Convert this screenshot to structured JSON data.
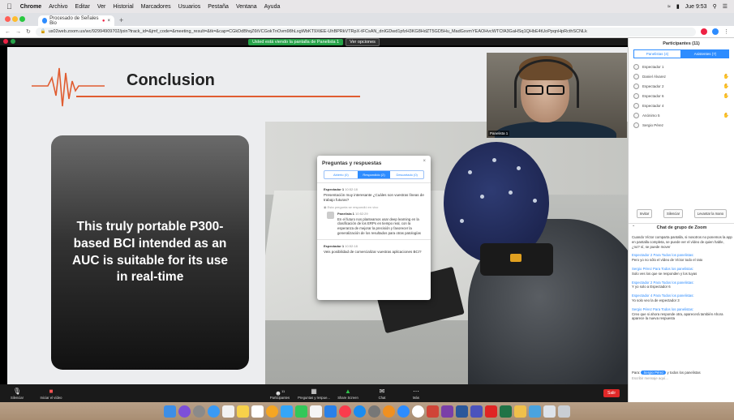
{
  "menubar": {
    "items": [
      "Chrome",
      "Archivo",
      "Editar",
      "Ver",
      "Historial",
      "Marcadores",
      "Usuarios",
      "Pestaña",
      "Ventana",
      "Ayuda"
    ],
    "clock": "Jue 9:53"
  },
  "browser": {
    "tab_title": "Procesado de Señales Bio",
    "url": "us02web.zoom.us/wc/92994909702/join?track_id=&jmf_code=&meeting_result=&tk=&cap=CGkDdBhqZ6tVCGokTnOvm98hLxgWbKT9XtEE-UhBPRkVTRpX-tFCsAN_dnIGDwd1pfzH3KG8HdZT5GD5Hu_MadGxvmYEAOHvcWTCfA3GaHSq1QHbE4tUoPpqnHpRcthSCNLk"
  },
  "share_banner": {
    "status": "Usted está viendo la pantalla de Panelista 1",
    "options": "Ver opciones"
  },
  "slide": {
    "title": "Conclusion",
    "callout": "This truly portable P300-based BCI intended as an AUC is suitable for its use in real-time"
  },
  "qa": {
    "title": "Preguntas y respuestas",
    "tabs": [
      {
        "label": "Abierto (0)",
        "active": false
      },
      {
        "label": "Respondido (2)",
        "active": true
      },
      {
        "label": "Descartado (0)",
        "active": false
      }
    ],
    "q1": {
      "author": "Espectador 1",
      "time": "10:52:18",
      "text": "Presentación muy interesante ¿Cuáles son vuestras líneas de trabajo futuras?",
      "note": "Esta pregunta se respondió en vivo"
    },
    "a1": {
      "author": "Panelista 1",
      "time": "10:52:29",
      "text": "En el futuro nos planteamos usar deep learning en la clasificación de los ERPs en tiempo real, con la esperanza de mejorar la precisión y favorecer la generalización de los resultados para otras patologías"
    },
    "q2": {
      "author": "Espectador 1",
      "time": "10:52:18",
      "text": "Veis posibilidad de comercializar vuestras aplicaciones BCI?"
    }
  },
  "video": {
    "name": "Panelista 1"
  },
  "panel": {
    "title": "Participantes (11)",
    "tabs": [
      {
        "label": "Panelistas (4)",
        "active": false
      },
      {
        "label": "Asistentes (7)",
        "active": true
      }
    ],
    "participants": [
      {
        "name": "Espectador 1",
        "hand": false
      },
      {
        "name": "Daniel Álvarez",
        "hand": true
      },
      {
        "name": "Espectador 2",
        "hand": true
      },
      {
        "name": "Espectador 6",
        "hand": true
      },
      {
        "name": "Espectador 4",
        "hand": false
      },
      {
        "name": "Anónimo 5",
        "hand": true
      },
      {
        "name": "Sergio Pérez",
        "hand": false
      }
    ],
    "buttons": [
      "Invitar",
      "Silenciar",
      "Levantar la mano"
    ],
    "chat_title": "Chat de grupo de Zoom",
    "chat": [
      {
        "from": "",
        "text": "Cuando Víctor comparta pantalla, si nosotros no ponemos la app en pantalla completa, se puede ver el vídeo de quien hable, ¿no? sí, se puede mover"
      },
      {
        "from": "Espectador 2 Para Todos los panelistas:",
        "text": "Pero yo no sólo el vídeo de Víctor todo el rato"
      },
      {
        "from": "Sergio Pérez Para Todos los panelistas:",
        "text": "Solo ves los que se responden y los tuyas"
      },
      {
        "from": "Espectador 2 Para Todos los panelistas:",
        "text": "Y yo solo a Espectador 6"
      },
      {
        "from": "Espectador 4 Para Todos los panelistas:",
        "text": "Yo solo veo la de espectador 3"
      },
      {
        "from": "Sergio Pérez Para Todos los panelistas:",
        "text": "Creo que si ahora responde otra, aparecerá también Ahora aparece la nueva respuesta"
      }
    ],
    "chat_to_label": "Para:",
    "chat_to_target": "Sergio Pérez",
    "chat_to_suffix": "y todos los panelistas",
    "chat_placeholder": "Escribir mensaje aquí..."
  },
  "toolbar": {
    "left": [
      {
        "label": "Silenciar",
        "icon": "microphone-icon"
      },
      {
        "label": "Iniciar el vídeo",
        "icon": "video-off-icon"
      }
    ],
    "middle": [
      {
        "label": "Participantes",
        "badge": "11",
        "icon": "participants-icon"
      },
      {
        "label": "Preguntas y respue...",
        "icon": "qa-icon"
      },
      {
        "label": "Share Screen",
        "icon": "share-screen-icon"
      },
      {
        "label": "Chat",
        "icon": "chat-icon"
      },
      {
        "label": "Más",
        "icon": "more-icon"
      }
    ],
    "leave": "Salir"
  },
  "colors": {
    "zoom_blue": "#2d8cff",
    "share_green": "#26a349",
    "leave_red": "#e02828",
    "title_accent": "#e05c30"
  }
}
